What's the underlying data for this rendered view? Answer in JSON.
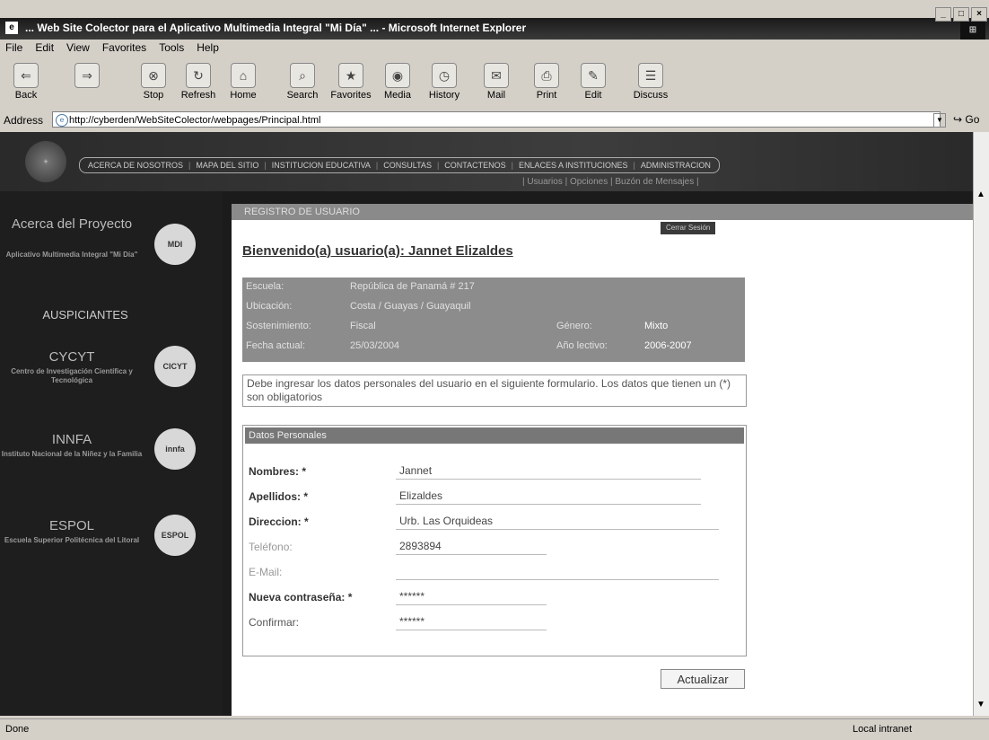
{
  "window": {
    "title": "... Web Site Colector para el Aplicativo Multimedia Integral \"Mi Día\" ... - Microsoft Internet Explorer",
    "minimize": "_",
    "maximize": "□",
    "close": "×"
  },
  "menu": [
    "File",
    "Edit",
    "View",
    "Favorites",
    "Tools",
    "Help"
  ],
  "toolbar": {
    "back": "Back",
    "forward": "",
    "stop": "Stop",
    "refresh": "Refresh",
    "home": "Home",
    "search": "Search",
    "favorites": "Favorites",
    "media": "Media",
    "history": "History",
    "mail": "Mail",
    "print": "Print",
    "edit": "Edit",
    "discuss": "Discuss"
  },
  "address": {
    "label": "Address",
    "url": "http://cyberden/WebSiteColector/webpages/Principal.html",
    "go": "Go"
  },
  "header": {
    "topnav": [
      "ACERCA DE NOSOTROS",
      "MAPA DEL SITIO",
      "INSTITUCION EDUCATIVA",
      "CONSULTAS",
      "CONTACTENOS",
      "ENLACES A INSTITUCIONES",
      "ADMINISTRACION"
    ],
    "subnav": "| Usuarios | Opciones | Buzón de Mensajes |"
  },
  "sidebar": {
    "project_title": "Acerca del Proyecto",
    "project_desc": "Aplicativo Multimedia Integral \"Mi Día\"",
    "sponsors_heading": "AUSPICIANTES",
    "sponsors": [
      {
        "name": "CYCYT",
        "desc": "Centro de Investigación Científica y Tecnológica"
      },
      {
        "name": "INNFA",
        "desc": "Instituto Nacional de la Niñez y la Familia"
      },
      {
        "name": "ESPOL",
        "desc": "Escuela Superior Politécnica del Litoral"
      }
    ],
    "badges": [
      "MDI",
      "CICYT",
      "innfa",
      "ESPOL"
    ]
  },
  "main": {
    "section_title": "REGISTRO DE USUARIO",
    "logout": "Cerrar Sesión",
    "welcome": "Bienvenido(a) usuario(a): Jannet Elizaldes",
    "school_info": {
      "escuela_label": "Escuela:",
      "escuela_value": "República de Panamá # 217",
      "ubicacion_label": "Ubicación:",
      "ubicacion_value": "Costa / Guayas / Guayaquil",
      "sostenimiento_label": "Sostenimiento:",
      "sostenimiento_value": "Fiscal",
      "genero_label": "Género:",
      "genero_value": "Mixto",
      "fecha_label": "Fecha actual:",
      "fecha_value": "25/03/2004",
      "anio_label": "Año lectivo:",
      "anio_value": "2006-2007"
    },
    "instructions": "Debe ingresar los datos personales del usuario en el siguiente formulario. Los datos que tienen un (*) son obligatorios",
    "form": {
      "heading": "Datos Personales",
      "fields": [
        {
          "label": "Nombres: *",
          "value": "Jannet"
        },
        {
          "label": "Apellidos: *",
          "value": "Elizaldes"
        },
        {
          "label": "Direccion: *",
          "value": "Urb. Las Orquideas"
        },
        {
          "label": "Teléfono:",
          "value": "2893894"
        },
        {
          "label": "E-Mail:",
          "value": ""
        },
        {
          "label": "Nueva contraseña: *",
          "value": "******"
        },
        {
          "label": "Confirmar:",
          "value": "******"
        }
      ],
      "submit": "Actualizar"
    }
  },
  "status": {
    "left": "Done",
    "zone": "Local intranet"
  },
  "colors": {
    "page_bg": "#1b1b1b",
    "header_bar": "#8a8a8a",
    "info_box": "#8c8c8c"
  }
}
